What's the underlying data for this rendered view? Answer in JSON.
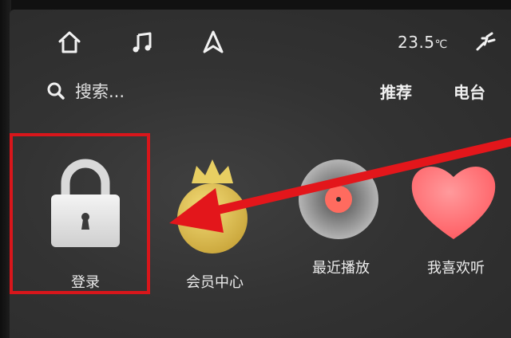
{
  "topbar": {
    "icons": [
      "home-icon",
      "music-note-icon",
      "navigation-icon",
      "climate-icon"
    ],
    "temperature_value": "23.5",
    "temperature_unit": "℃"
  },
  "search": {
    "placeholder": "搜索..."
  },
  "tabs": {
    "recommend": "推荐",
    "radio": "电台"
  },
  "tiles": [
    {
      "label": "登录",
      "icon": "lock-icon"
    },
    {
      "label": "会员中心",
      "icon": "crown-coin-icon"
    },
    {
      "label": "最近播放",
      "icon": "vinyl-record-icon"
    },
    {
      "label": "我喜欢听",
      "icon": "heart-icon"
    }
  ],
  "colors": {
    "highlight_border": "#d8161b",
    "arrow": "#e3161b",
    "gold": "#e2c34a",
    "heart": "#ff6b70"
  }
}
